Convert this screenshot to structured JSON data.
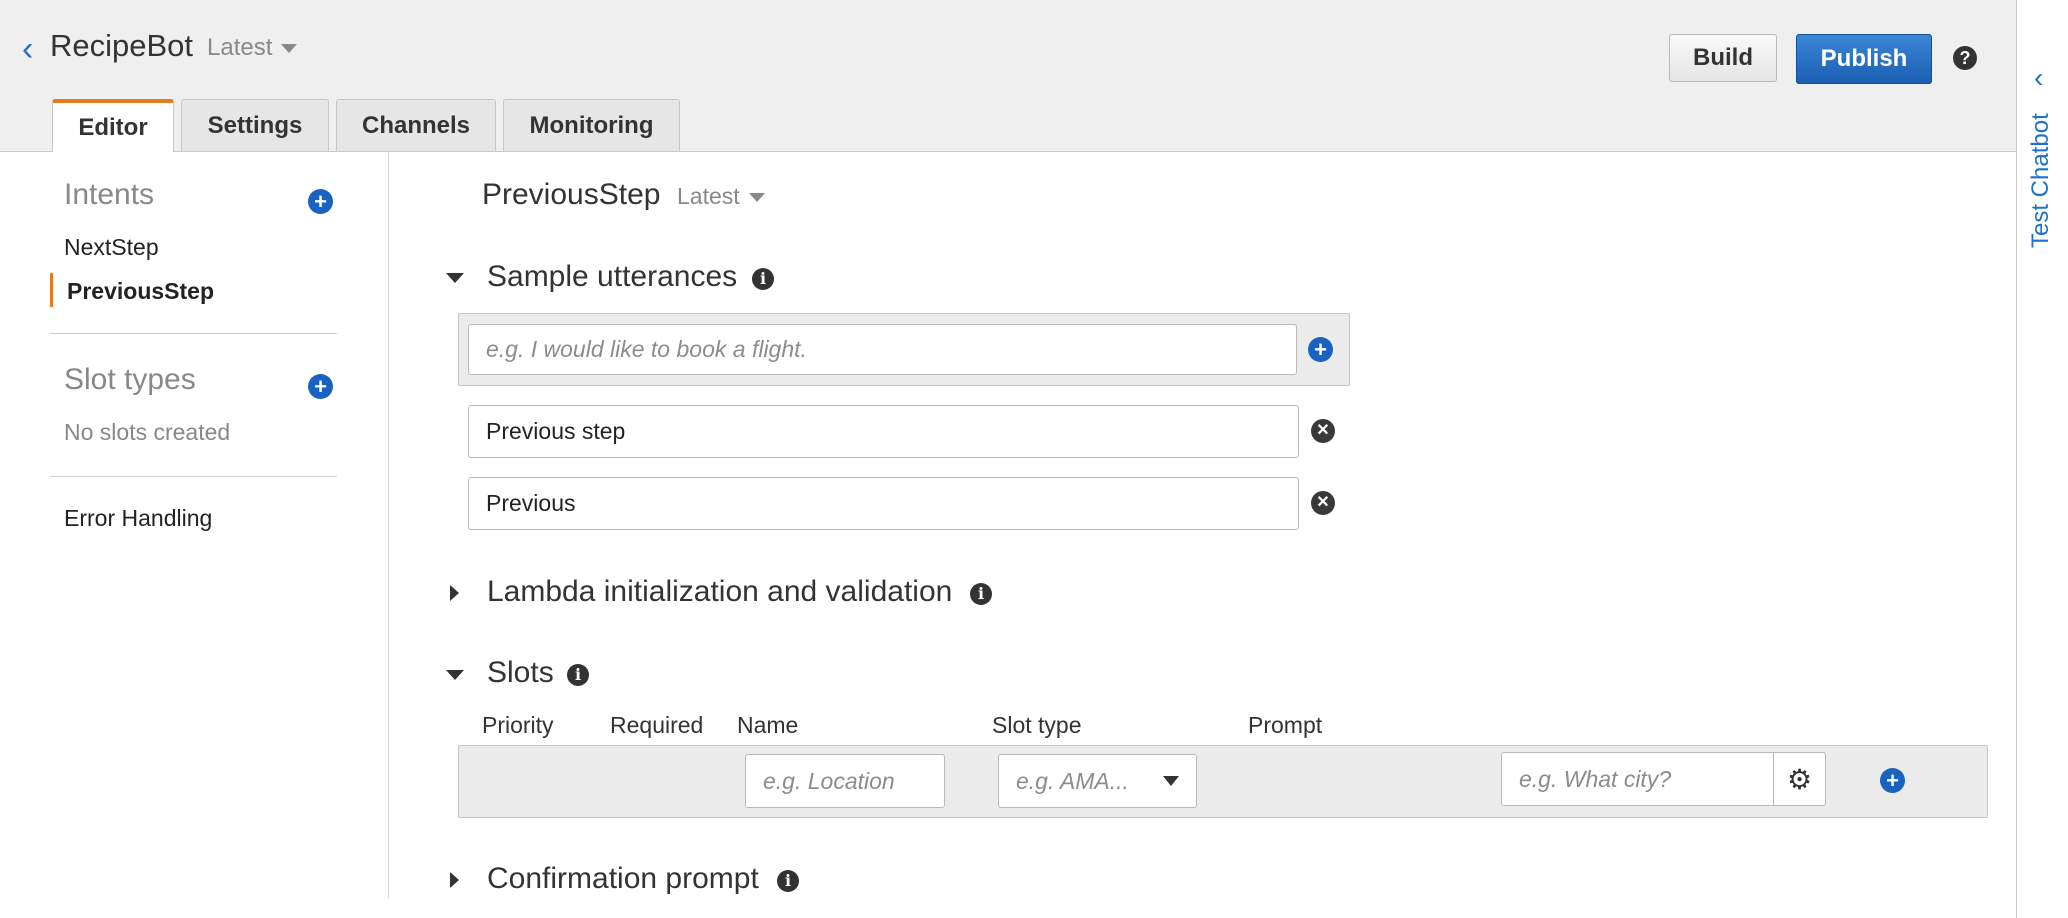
{
  "header": {
    "back_icon": "chevron-left-icon",
    "bot_name": "RecipeBot",
    "version_label": "Latest",
    "build_label": "Build",
    "publish_label": "Publish",
    "help_icon": "?",
    "tabs": [
      {
        "label": "Editor",
        "active": true
      },
      {
        "label": "Settings",
        "active": false
      },
      {
        "label": "Channels",
        "active": false
      },
      {
        "label": "Monitoring",
        "active": false
      }
    ]
  },
  "right_panel": {
    "label": "Test Chatbot",
    "chevron_icon": "chevron-left-icon"
  },
  "sidebar": {
    "intents_heading": "Intents",
    "intents": [
      "NextStep",
      "PreviousStep"
    ],
    "selected_intent": "PreviousStep",
    "slot_types_heading": "Slot types",
    "no_slots_text": "No slots created",
    "error_handling_label": "Error Handling"
  },
  "intent_editor": {
    "intent_name": "PreviousStep",
    "version_label": "Latest",
    "sample_utterances": {
      "title": "Sample utterances",
      "placeholder": "e.g. I would like to book a flight.",
      "items": [
        "Previous step",
        "Previous"
      ]
    },
    "lambda_section_title": "Lambda initialization and validation",
    "slots": {
      "title": "Slots",
      "columns": [
        "Priority",
        "Required",
        "Name",
        "Slot type",
        "Prompt"
      ],
      "name_placeholder": "e.g. Location",
      "slot_type_placeholder": "e.g. AMA...",
      "prompt_placeholder": "e.g. What city?"
    },
    "confirmation_section_title": "Confirmation prompt"
  },
  "colors": {
    "accent_blue": "#1a62c0",
    "tab_active_orange": "#e47b1f",
    "publish_blue": "#1b5fb2"
  }
}
